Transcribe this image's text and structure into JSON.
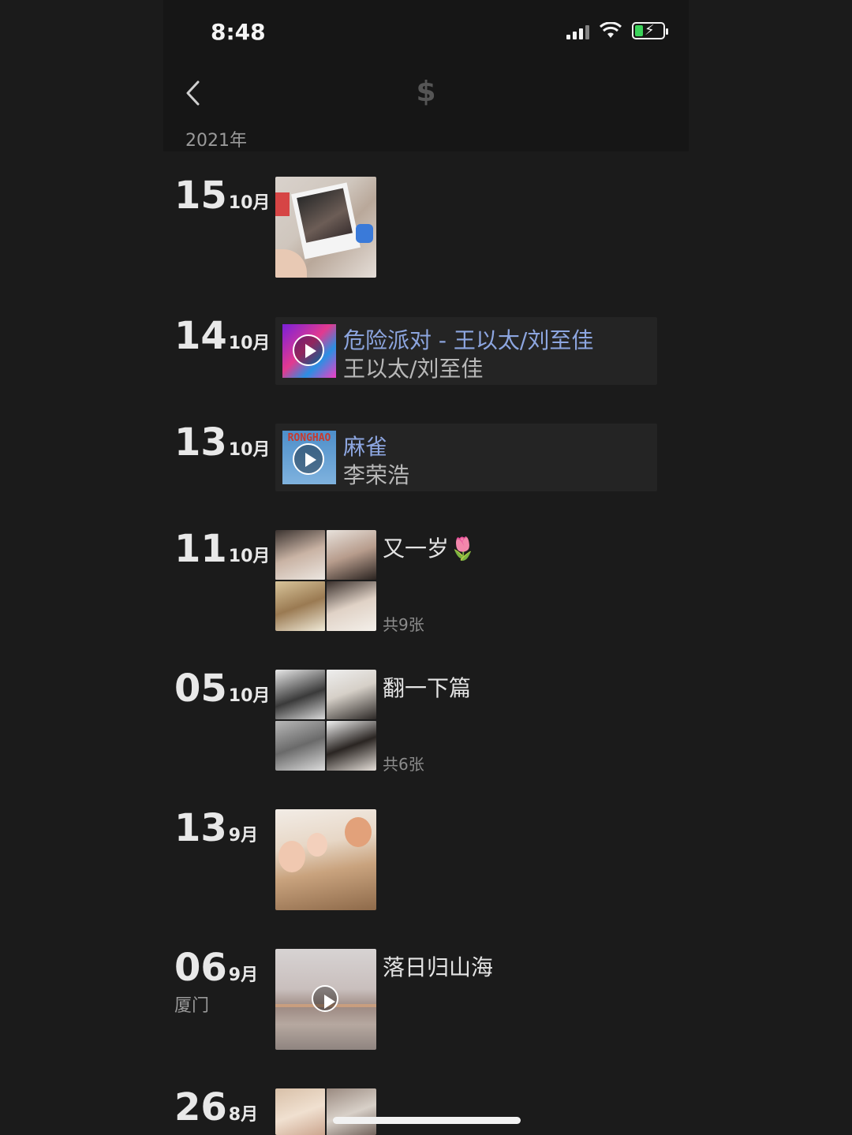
{
  "status_bar": {
    "time": "8:48"
  },
  "header": {
    "title": "$",
    "year": "2021年"
  },
  "entries": [
    {
      "day": "15",
      "month": "10月",
      "type": "photo"
    },
    {
      "day": "14",
      "month": "10月",
      "type": "music",
      "song_title": "危险派对 - 王以太/刘至佳",
      "artist": "王以太/刘至佳"
    },
    {
      "day": "13",
      "month": "10月",
      "type": "music",
      "song_title": "麻雀",
      "artist": "李荣浩",
      "cover_text": "RONGHAO"
    },
    {
      "day": "11",
      "month": "10月",
      "type": "album",
      "title": "又一岁🌷",
      "count": "共9张"
    },
    {
      "day": "05",
      "month": "10月",
      "type": "album",
      "title": "翻一下篇",
      "count": "共6张"
    },
    {
      "day": "13",
      "month": "9月",
      "type": "photo"
    },
    {
      "day": "06",
      "month": "9月",
      "type": "video",
      "place": "厦门",
      "title": "落日归山海"
    },
    {
      "day": "26",
      "month": "8月",
      "type": "album"
    }
  ]
}
